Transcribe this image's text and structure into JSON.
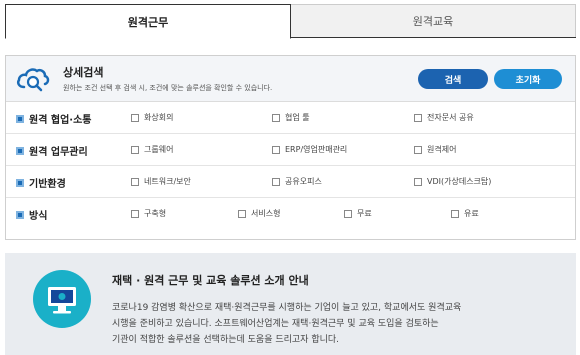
{
  "tabs": [
    {
      "label": "원격근무",
      "active": true
    },
    {
      "label": "원격교육",
      "active": false
    }
  ],
  "search_panel": {
    "title": "상세검색",
    "description": "원하는 조건 선택 후 검색 시, 조건에 맞는 솔루션을 확인할 수 있습니다.",
    "search_button": "검색",
    "reset_button": "초기화",
    "rows": [
      {
        "label": "원격 협업·소통",
        "options": [
          "화상회의",
          "협업 툴",
          "전자문서 공유"
        ]
      },
      {
        "label": "원격 업무관리",
        "options": [
          "그룹웨어",
          "ERP/영업판매관리",
          "원격제어"
        ]
      },
      {
        "label": "기반환경",
        "options": [
          "네트워크/보안",
          "공유오피스",
          "VDI(가상데스크탑)"
        ]
      },
      {
        "label": "방식",
        "options": [
          "구축형",
          "서비스형",
          "무료",
          "유료"
        ]
      }
    ]
  },
  "banner": {
    "title": "재택 · 원격 근무 및 교육 솔루션 소개 안내",
    "lines": [
      "코로나19 감염병 확산으로 재택·원격근무를 시행하는 기업이 늘고 있고, 학교에서도 원격교육",
      "시행을 준비하고 있습니다. 소프트웨어산업계는 재택·원격근무 및 교육 도입을 검토하는",
      "기관이 적합한 솔루션을 선택하는데 도움을 드리고자 합니다."
    ]
  },
  "colors": {
    "primary_button": "#1c63b0",
    "secondary_button": "#1e8ed4",
    "icon_circle": "#1ab0c8",
    "banner_bg": "#e9ecf0"
  }
}
